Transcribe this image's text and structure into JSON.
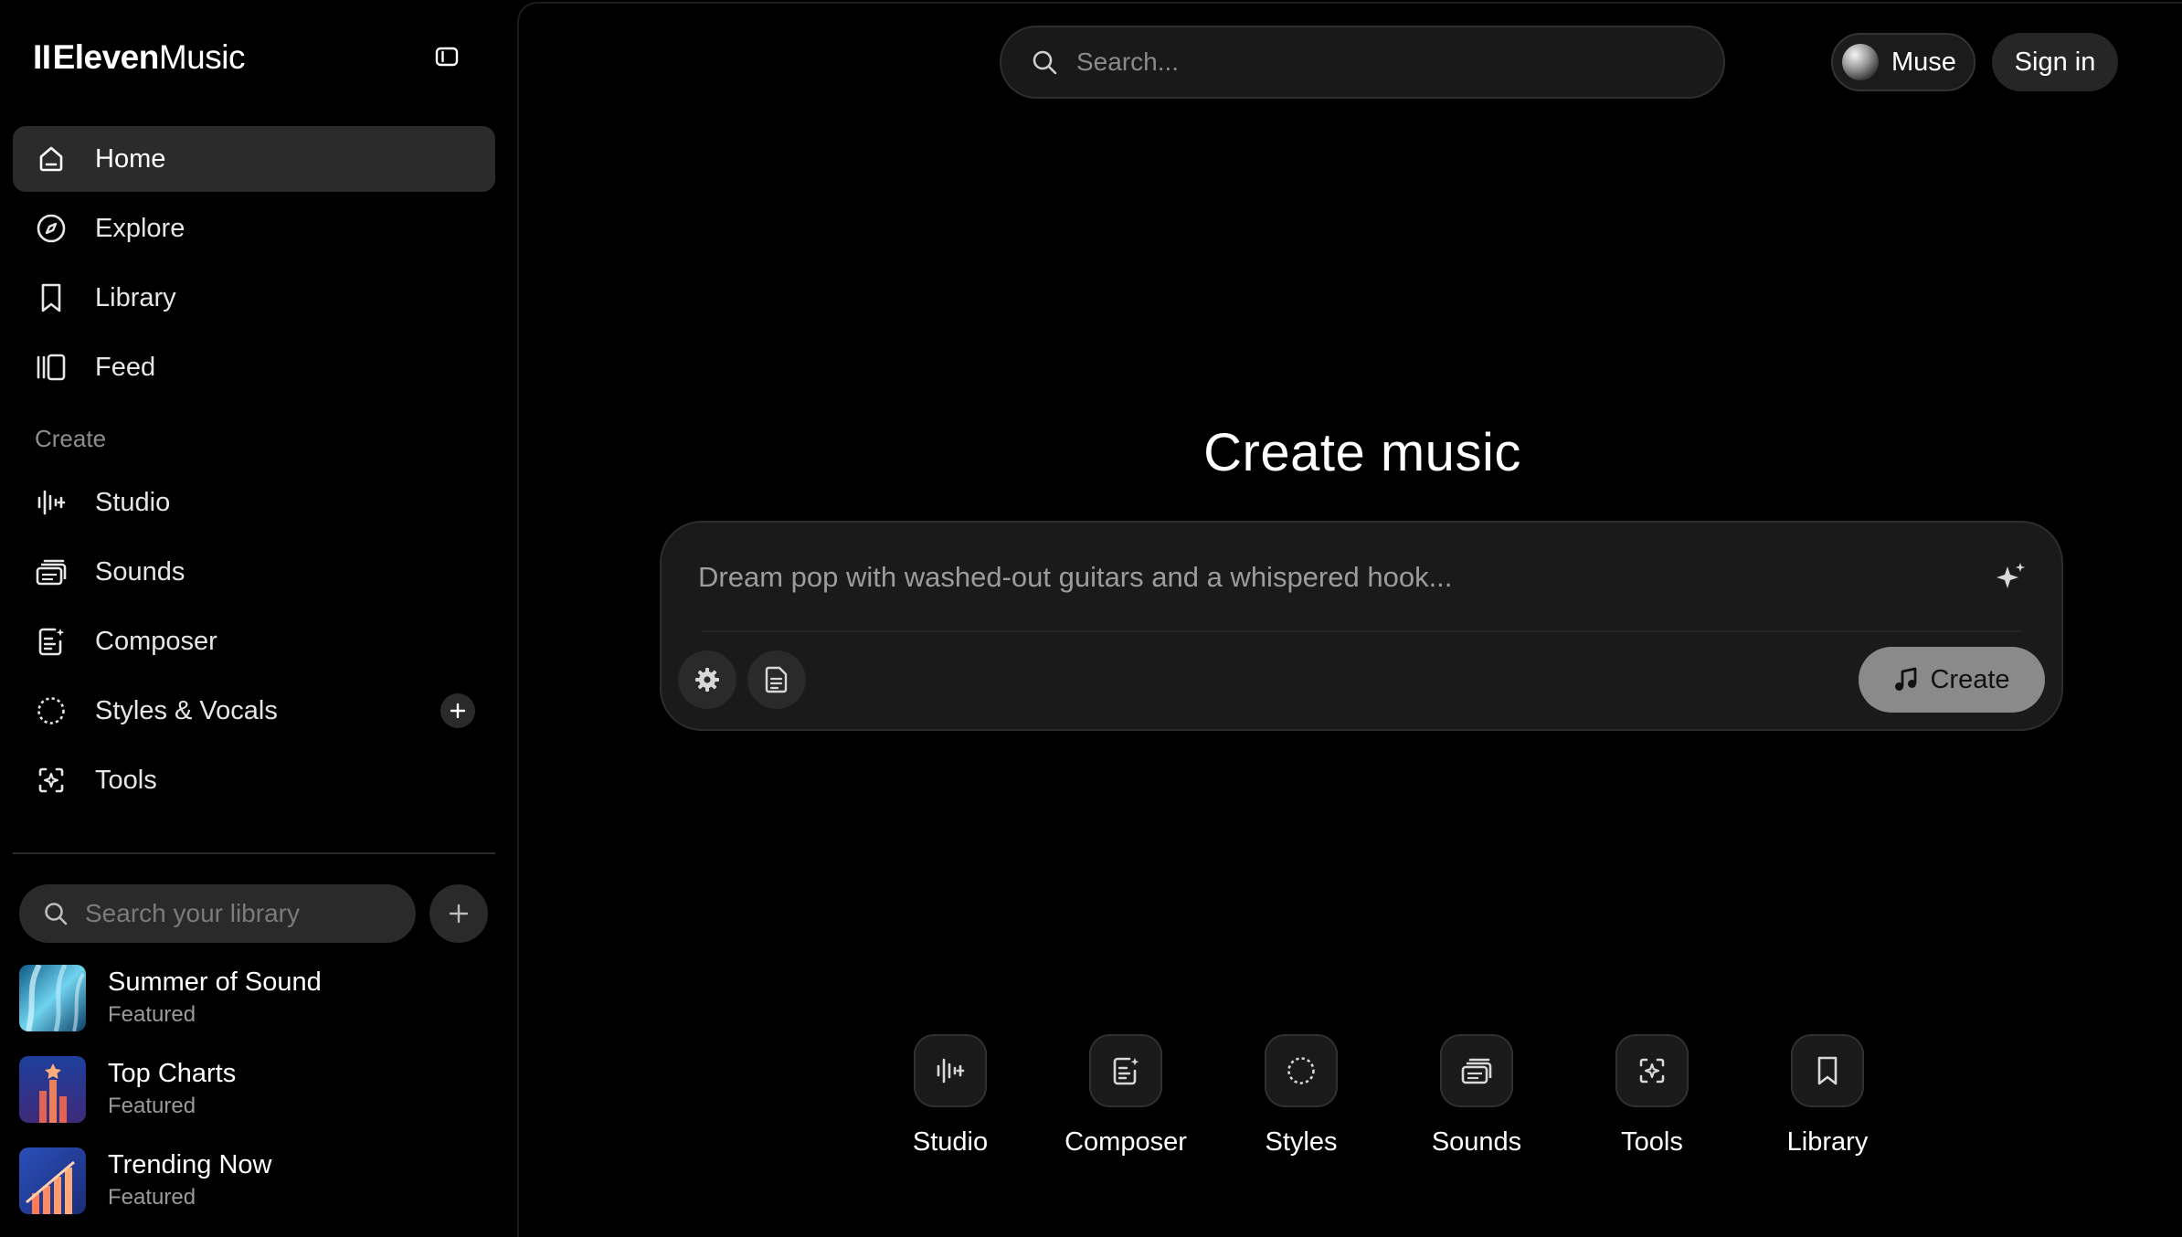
{
  "brand": {
    "mark": "II",
    "bold": "Eleven",
    "regular": "Music"
  },
  "sidebar": {
    "nav": [
      {
        "label": "Home",
        "icon": "home-icon",
        "active": true
      },
      {
        "label": "Explore",
        "icon": "compass-icon"
      },
      {
        "label": "Library",
        "icon": "bookmark-icon"
      },
      {
        "label": "Feed",
        "icon": "feed-icon"
      }
    ],
    "create_section": "Create",
    "create_items": [
      {
        "label": "Studio",
        "icon": "studio-icon"
      },
      {
        "label": "Sounds",
        "icon": "sounds-icon"
      },
      {
        "label": "Composer",
        "icon": "composer-icon"
      },
      {
        "label": "Styles & Vocals",
        "icon": "styles-icon"
      },
      {
        "label": "Tools",
        "icon": "tools-icon"
      }
    ],
    "library_search_placeholder": "Search your library",
    "playlists": [
      {
        "title": "Summer of Sound",
        "subtitle": "Featured"
      },
      {
        "title": "Top Charts",
        "subtitle": "Featured"
      },
      {
        "title": "Trending Now",
        "subtitle": "Featured"
      }
    ]
  },
  "header": {
    "search_placeholder": "Search...",
    "muse_label": "Muse",
    "signin_label": "Sign in"
  },
  "main": {
    "title": "Create music",
    "prompt_placeholder": "Dream pop with washed-out guitars and a whispered hook...",
    "create_label": "Create",
    "quick_links": [
      {
        "label": "Studio",
        "icon": "studio-icon"
      },
      {
        "label": "Composer",
        "icon": "composer-icon"
      },
      {
        "label": "Styles",
        "icon": "styles-icon"
      },
      {
        "label": "Sounds",
        "icon": "sounds-icon"
      },
      {
        "label": "Tools",
        "icon": "tools-icon"
      },
      {
        "label": "Library",
        "icon": "bookmark-icon"
      }
    ]
  },
  "colors": {
    "background": "#000000",
    "active_nav": "#2b2b2b",
    "panel": "#1a1a1a",
    "create_button": "#8a8a8a",
    "muted_text": "#8d8d8d"
  }
}
